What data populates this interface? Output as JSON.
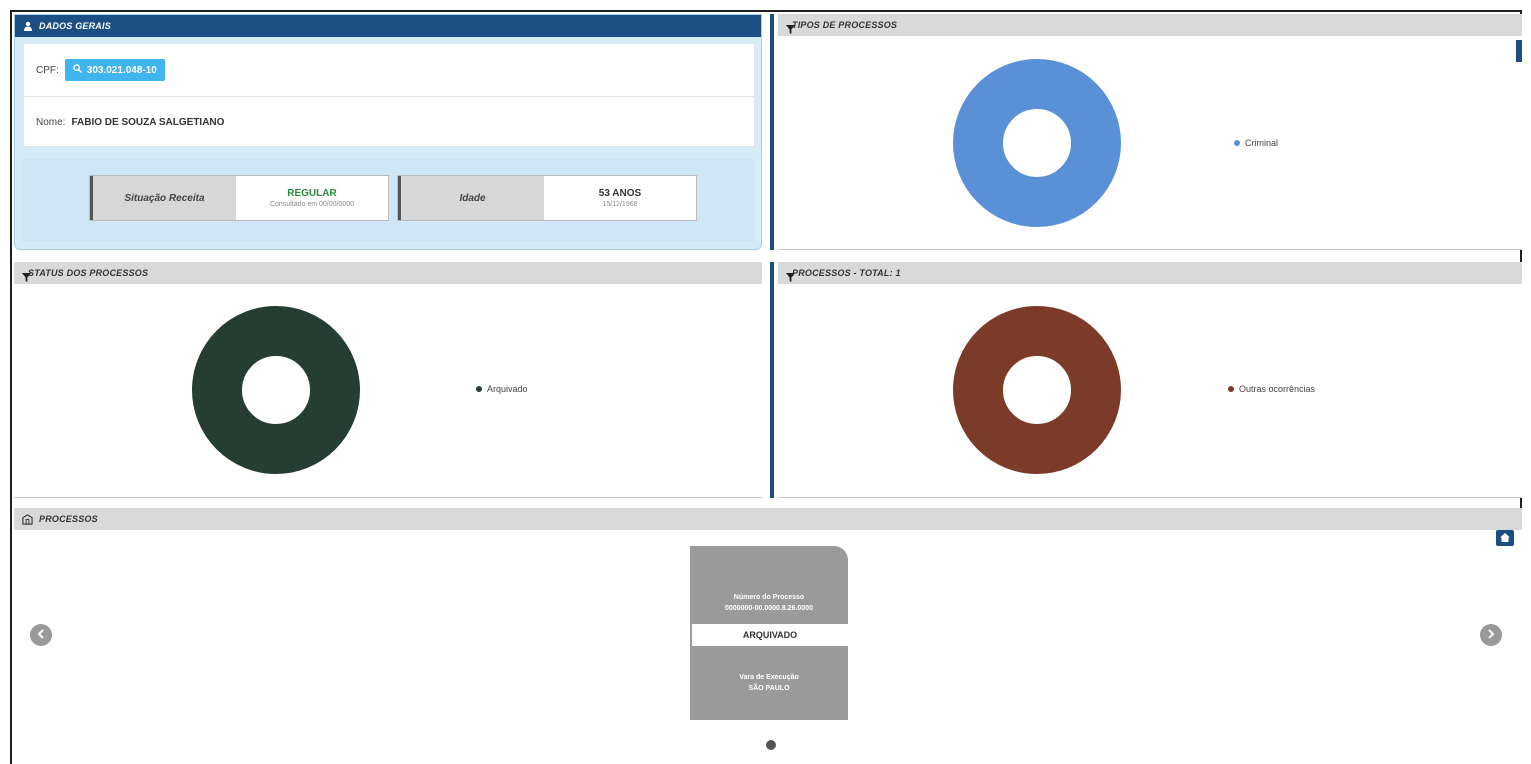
{
  "dados_gerais": {
    "title": "DADOS GERAIS",
    "cpf_label": "CPF:",
    "cpf_value": "303.021.048-10",
    "nome_label": "Nome:",
    "nome_value": "FABIO DE SOUZA SALGETIANO",
    "situacao": {
      "label": "Situação Receita",
      "value": "REGULAR",
      "sub": "Consultado em 00/00/0000"
    },
    "idade": {
      "label": "Idade",
      "value": "53 ANOS",
      "sub": "15/12/1968"
    }
  },
  "tipos": {
    "title": "TIPOS DE PROCESSOS",
    "legend": "Criminal",
    "color": "#5a91d6"
  },
  "status": {
    "title": "STATUS DOS PROCESSOS",
    "legend": "Arquivado",
    "color": "#263d31"
  },
  "total": {
    "title": "PROCESSOS - TOTAL: 1",
    "legend": "Outras ocorrências",
    "color": "#7b3b28"
  },
  "processos": {
    "title": "PROCESSOS",
    "card_top_line1": "Número do Processo",
    "card_top_line2": "0000000-00.0000.8.26.0000",
    "card_status": "ARQUIVADO",
    "card_bottom_line1": "Vara de Execução",
    "card_bottom_line2": "SÃO PAULO"
  },
  "chart_data": [
    {
      "type": "pie",
      "title": "TIPOS DE PROCESSOS",
      "categories": [
        "Criminal"
      ],
      "values": [
        1
      ]
    },
    {
      "type": "pie",
      "title": "STATUS DOS PROCESSOS",
      "categories": [
        "Arquivado"
      ],
      "values": [
        1
      ]
    },
    {
      "type": "pie",
      "title": "PROCESSOS - TOTAL: 1",
      "categories": [
        "Outras ocorrências"
      ],
      "values": [
        1
      ]
    }
  ]
}
